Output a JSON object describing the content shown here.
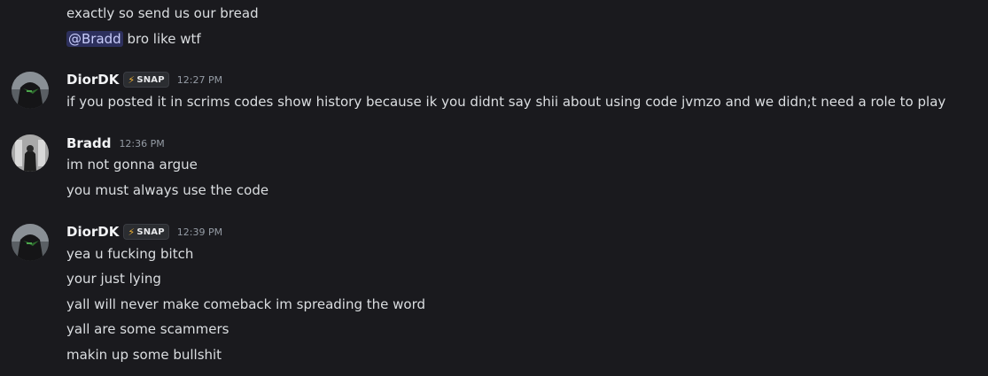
{
  "messages": [
    {
      "continuation": true,
      "lines": [
        "exactly so send us our bread"
      ]
    },
    {
      "continuation": true,
      "mention": "@Bradd",
      "mention_rest": " bro like wtf"
    },
    {
      "author": "DiorDK",
      "tag": "SNAP",
      "tag_icon": "lightning-bolt-icon",
      "timestamp": "12:27 PM",
      "avatar": "dark-figure-green-mask-avatar",
      "lines": [
        "if you posted it in scrims codes show history because ik you didnt say shii about using code jvmzo and we didn;t need a role to play"
      ]
    },
    {
      "author": "Bradd",
      "timestamp": "12:36 PM",
      "avatar": "grayscale-figure-avatar",
      "lines": [
        "im not gonna argue",
        "you must always use the code"
      ]
    },
    {
      "author": "DiorDK",
      "tag": "SNAP",
      "tag_icon": "lightning-bolt-icon",
      "timestamp": "12:39 PM",
      "avatar": "dark-figure-green-mask-avatar",
      "lines": [
        "yea u fucking bitch",
        "your just lying",
        "yall will never make comeback im spreading the word",
        "yall are some scammers",
        "makin up some bullshit"
      ]
    }
  ],
  "colors": {
    "background": "#1a1a1e",
    "text": "#dbdee1",
    "username": "#f2f3f5",
    "timestamp": "#949ba4",
    "mention_bg": "#3c4270",
    "mention_text": "#c9cdfb",
    "bolt": "#f0b232"
  }
}
